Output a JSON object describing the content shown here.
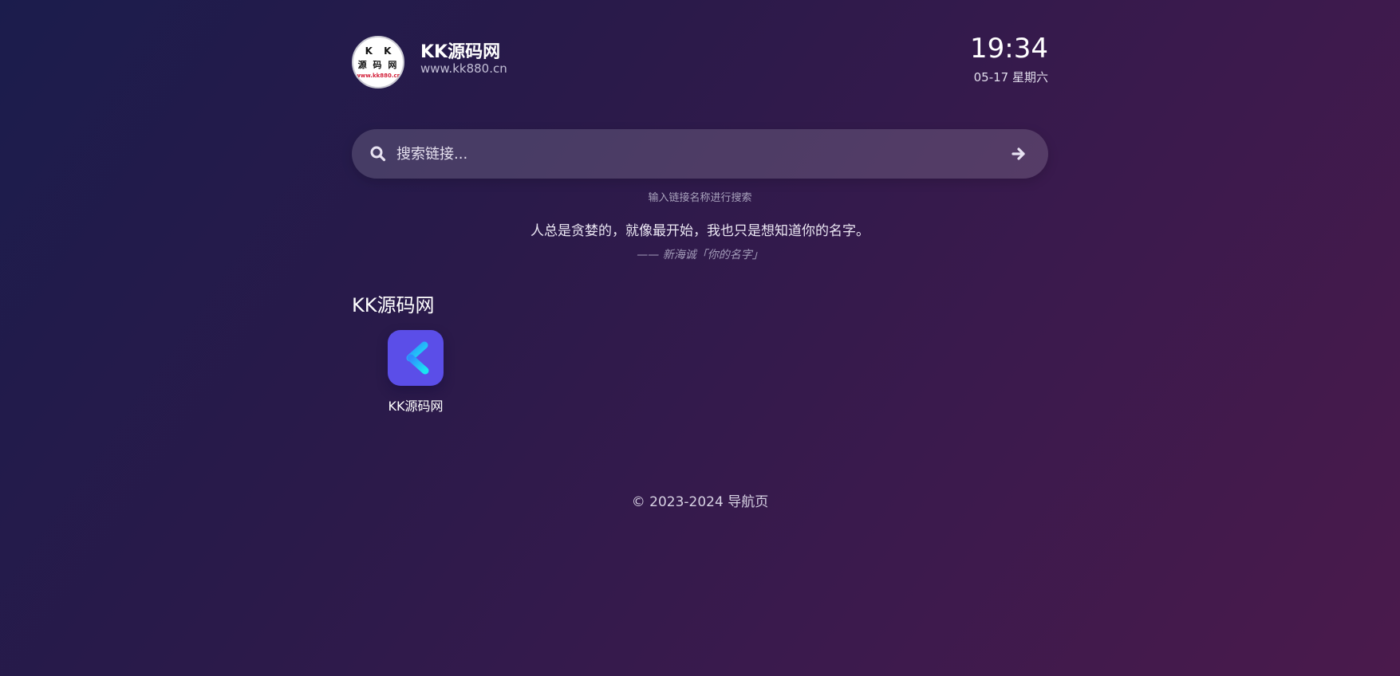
{
  "header": {
    "logo": {
      "line1": "K K",
      "line2": "源 码 网",
      "line3": "www.kk880.cn"
    },
    "site_name": "KK源码网",
    "site_url": "www.kk880.cn",
    "time": "19:34",
    "date": "05-17 星期六"
  },
  "search": {
    "placeholder": "搜索链接...",
    "value": "",
    "hint": "输入链接名称进行搜索",
    "icon": "search-icon",
    "submit_icon": "arrow-right-icon"
  },
  "quote": {
    "text": "人总是贪婪的，就像最开始，我也只是想知道你的名字。",
    "source": "—— 新海诚「你的名字」"
  },
  "sections": [
    {
      "title": "KK源码网",
      "links": [
        {
          "label": "KK源码网",
          "icon": "k-app-icon"
        }
      ]
    }
  ],
  "footer": {
    "text": "© 2023-2024 导航页"
  },
  "colors": {
    "background_start": "#1b1c4c",
    "background_end": "#4a1a4c",
    "search_bg": "rgba(255,255,255,0.15)",
    "app_icon_bg": "#5b4ee8",
    "app_icon_glyph": "#16d4f5"
  }
}
